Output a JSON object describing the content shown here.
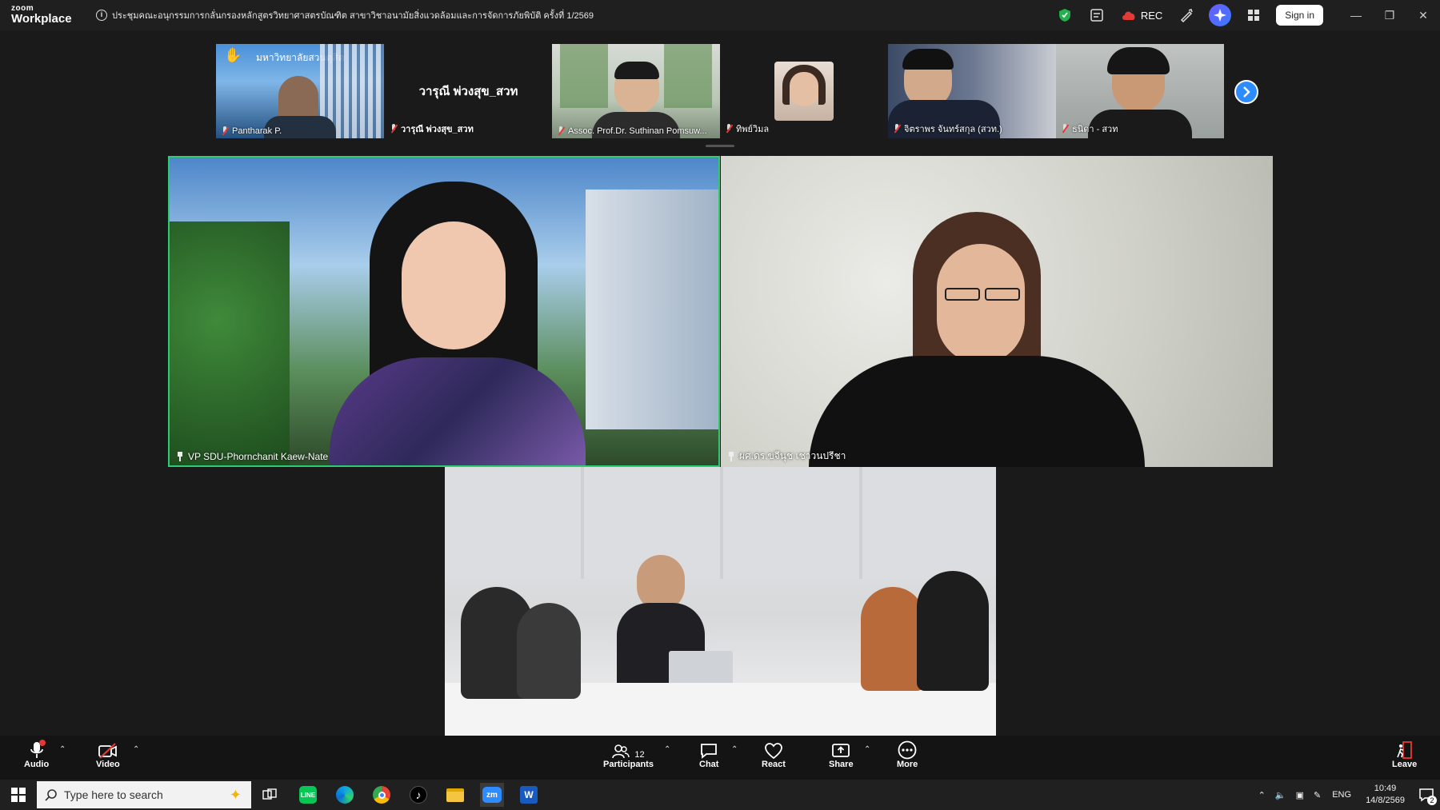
{
  "app": {
    "logo_top": "zoom",
    "logo_bottom": "Workplace"
  },
  "meeting": {
    "title": "ประชุมคณะอนุกรรมการกลั่นกรองหลักสูตรวิทยาศาสตรบัณฑิต สาขาวิชาอนามัยสิ่งแวดล้อมและการจัดการภัยพิบัติ ครั้งที่ 1/2569"
  },
  "titlebar": {
    "rec_label": "REC",
    "signin_label": "Sign in"
  },
  "strip": [
    {
      "name": "Pantharak P.",
      "banner": "มหาวิทยาลัยสวนดุสิต"
    },
    {
      "name": "วารุณี พ่วงสุข_สวท",
      "center_name": "วารุณี พ่วงสุข_สวท"
    },
    {
      "name": "Assoc. Prof.Dr. Suthinan Pomsuw..."
    },
    {
      "name": "ทิพย์วิมล"
    },
    {
      "name": "จิตราพร จันทร์สกุล (สวท.)"
    },
    {
      "name": "ธนิดา - สวท"
    }
  ],
  "main": {
    "speaker_name": "VP SDU-Phornchanit Kaew-Nate",
    "right_name": "ผศ.ดร.ขจีนุช เชาวนปรีชา",
    "room_name": ""
  },
  "toolbar": {
    "audio": "Audio",
    "video": "Video",
    "participants": "Participants",
    "participants_count": "12",
    "chat": "Chat",
    "react": "React",
    "share": "Share",
    "more": "More",
    "leave": "Leave"
  },
  "taskbar": {
    "search_placeholder": "Type here to search",
    "lang": "ENG",
    "time": "10:49",
    "date": "14/8/2569",
    "notif_count": "2"
  },
  "colors": {
    "active_border": "#2ecc71",
    "accent": "#2d8cff",
    "mute_red": "#e53935"
  }
}
